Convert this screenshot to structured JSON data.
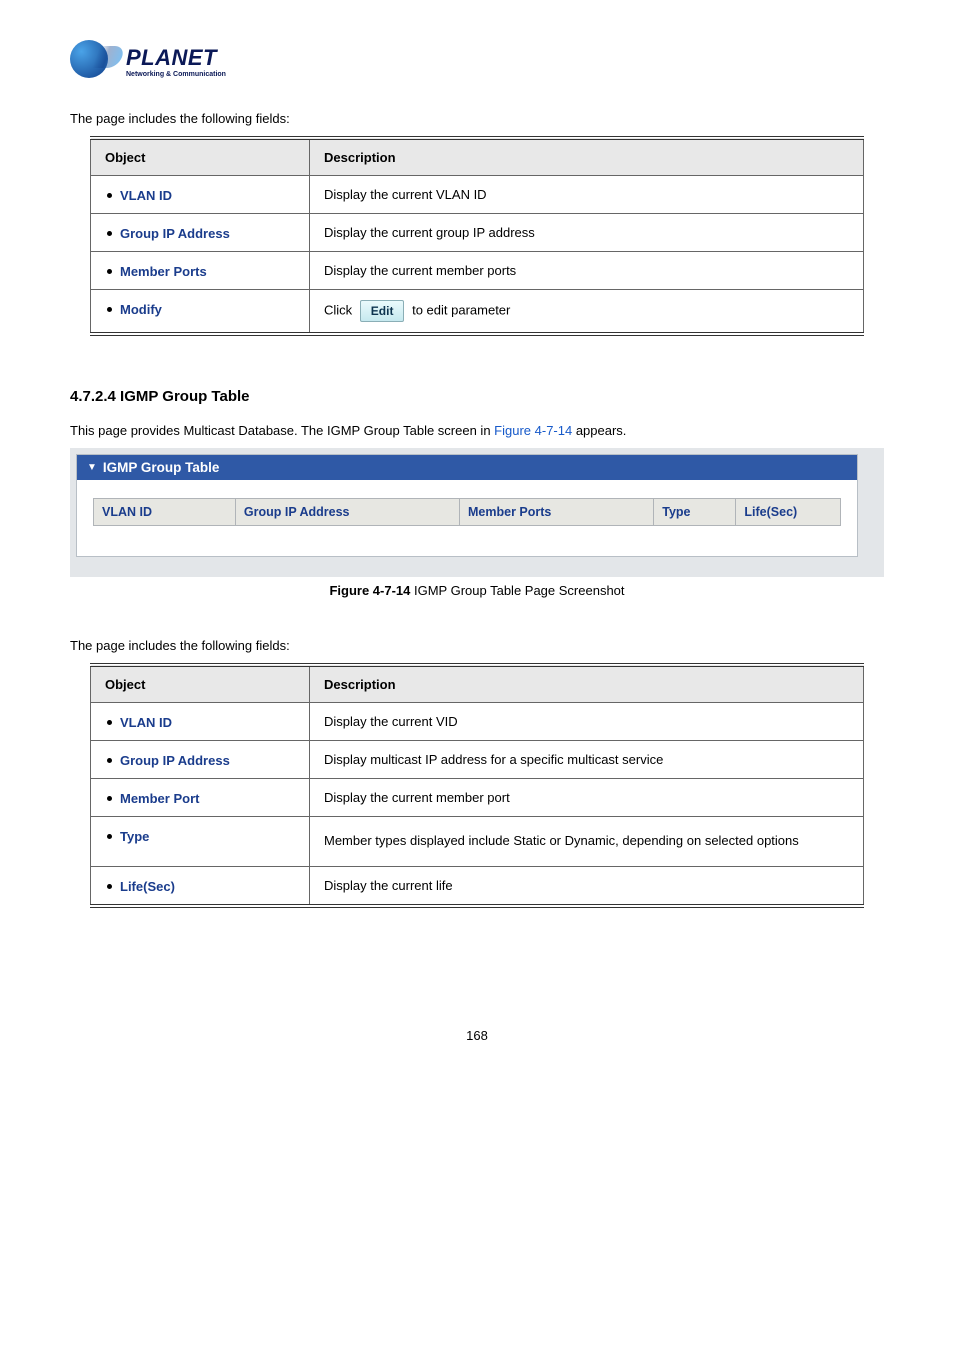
{
  "logo": {
    "brand": "PLANET",
    "tagline": "Networking & Communication"
  },
  "tables": {
    "intro": "The page includes the following fields:",
    "header": {
      "object": "Object",
      "description": "Description"
    },
    "t1": [
      {
        "obj": "VLAN ID",
        "desc_pre": "Display the current VLAN ID"
      },
      {
        "obj": "Group IP Address",
        "desc_pre": "Display the current group IP address"
      },
      {
        "obj": "Member Ports",
        "desc_pre": "Display the current member ports"
      },
      {
        "obj": "Modify",
        "desc_pre": "Click",
        "btn": "Edit",
        "desc_post": " to edit parameter"
      }
    ],
    "t2": [
      {
        "obj": "VLAN ID",
        "desc": "Display the current VID"
      },
      {
        "obj": "Group IP Address",
        "desc": "Display multicast IP address for a specific multicast service"
      },
      {
        "obj": "Member Port",
        "desc": "Display the current member port"
      },
      {
        "obj": "Type",
        "desc": "Member types displayed include Static or Dynamic, depending on selected options"
      },
      {
        "obj": "Life(Sec)",
        "desc": "Display the current life"
      }
    ]
  },
  "section": {
    "heading": "4.7.2.4 IGMP Group Table",
    "line_pre": "This page provides Multicast Database. The IGMP Group Table screen in ",
    "line_link": "Figure 4-7-14",
    "line_post": " appears."
  },
  "screenshot": {
    "panel_title": "IGMP Group Table",
    "cols": [
      "VLAN ID",
      "Group IP Address",
      "Member Ports",
      "Type",
      "Life(Sec)"
    ]
  },
  "caption": {
    "bold": "Figure 4-7-14",
    "rest": " IGMP Group Table Page Screenshot"
  },
  "pagenum": "168"
}
